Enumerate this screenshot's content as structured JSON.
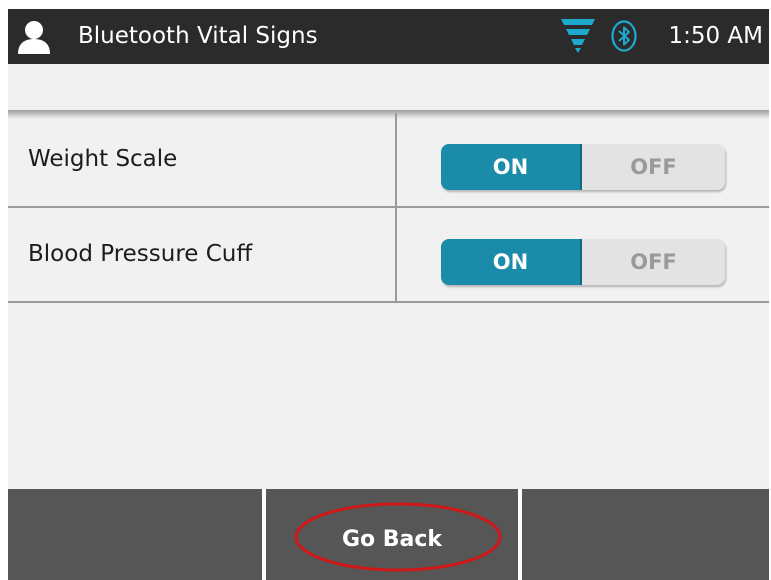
{
  "status_bar": {
    "title": "Bluetooth Vital Signs",
    "time": "1:50 AM",
    "icons": [
      "user-icon",
      "signal-icon",
      "bluetooth-icon"
    ]
  },
  "devices": [
    {
      "label": "Weight Scale",
      "on_label": "ON",
      "off_label": "OFF",
      "state": "ON"
    },
    {
      "label": "Blood Pressure Cuff",
      "on_label": "ON",
      "off_label": "OFF",
      "state": "ON"
    }
  ],
  "bottom_bar": {
    "go_back_label": "Go Back"
  },
  "colors": {
    "status_bar": "#2b2b2b",
    "accent": "#1a8ba8",
    "bottom_bar": "#565656",
    "highlight": "#d01818"
  }
}
